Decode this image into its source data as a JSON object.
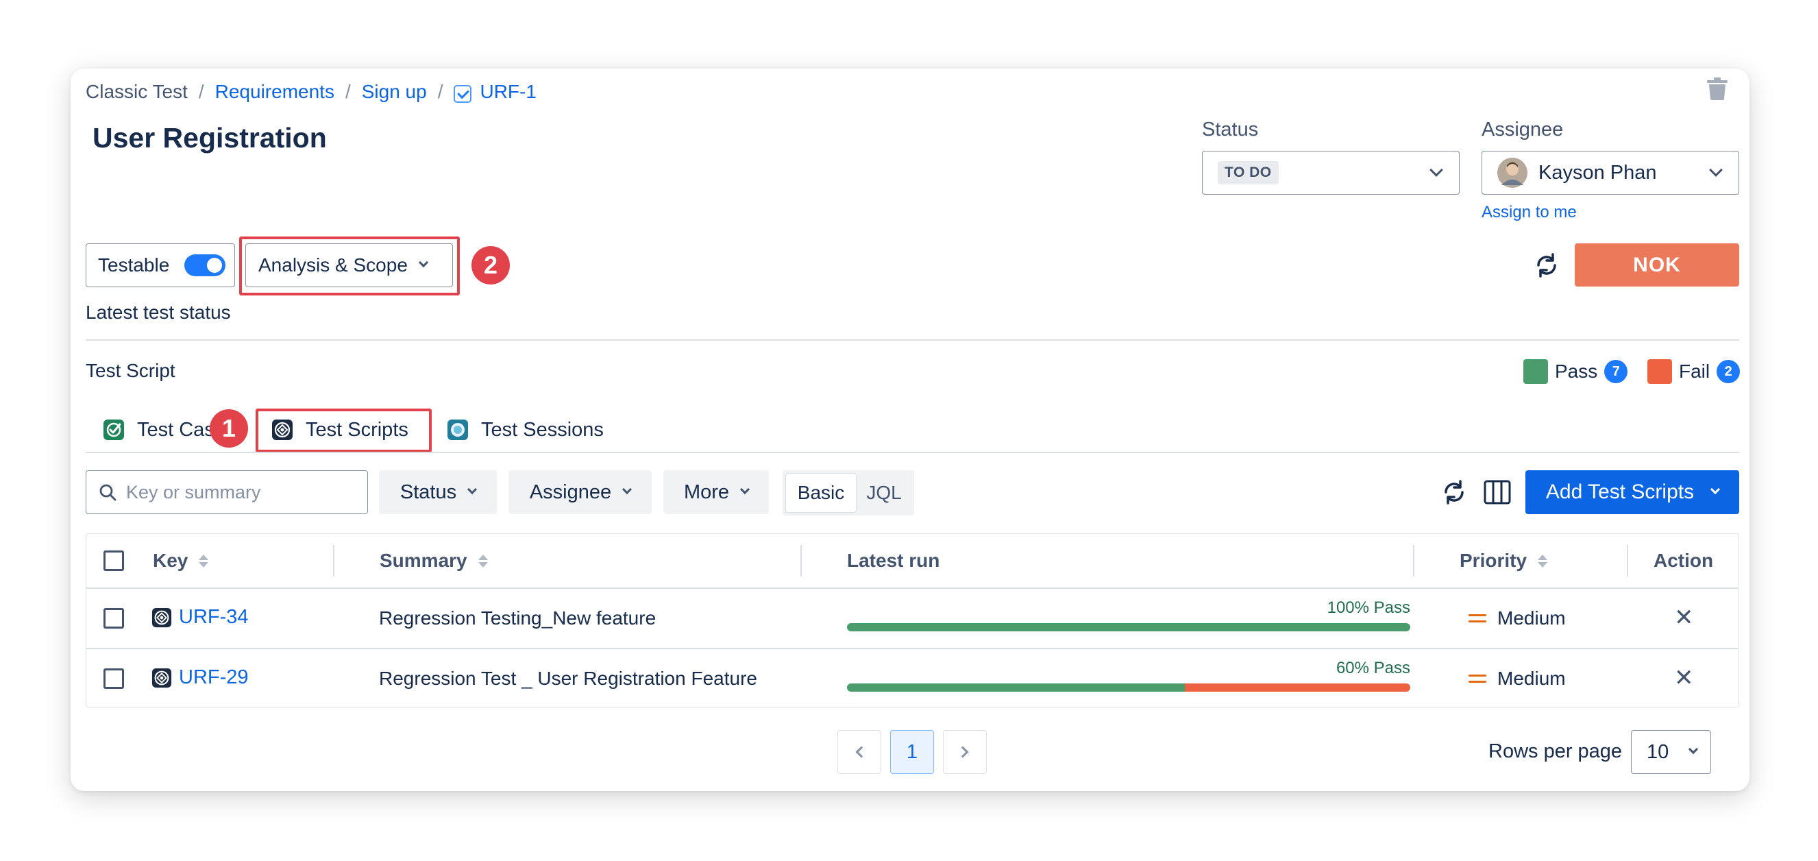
{
  "breadcrumb": {
    "project": "Classic Test",
    "requirements": "Requirements",
    "signup": "Sign up",
    "issue_key": "URF-1",
    "separator": "/"
  },
  "issue": {
    "title": "User Registration"
  },
  "status_field": {
    "label": "Status",
    "value": "TO DO"
  },
  "assignee_field": {
    "label": "Assignee",
    "value": "Kayson Phan",
    "assign_to_me": "Assign to me"
  },
  "controls": {
    "testable_label": "Testable",
    "testable_on": true,
    "analysis_label": "Analysis & Scope",
    "callout_1": "1",
    "callout_2": "2",
    "nok_label": "NOK"
  },
  "latest_status": "Latest test status",
  "test_script_label": "Test Script",
  "legend": {
    "pass_label": "Pass",
    "pass_count": "7",
    "pass_color": "#4a9c6d",
    "fail_label": "Fail",
    "fail_count": "2",
    "fail_color": "#ed6240"
  },
  "tabs": [
    {
      "label": "Test Cases",
      "icon": "test-case-icon"
    },
    {
      "label": "Test Scripts",
      "icon": "test-script-icon"
    },
    {
      "label": "Test Sessions",
      "icon": "test-session-icon"
    }
  ],
  "tab_visible_label_0": "Test Cas",
  "toolbar": {
    "search_placeholder": "Key or summary",
    "status": "Status",
    "assignee": "Assignee",
    "more": "More",
    "basic": "Basic",
    "jql": "JQL",
    "add_label": "Add Test Scripts"
  },
  "table": {
    "headers": {
      "key": "Key",
      "summary": "Summary",
      "latest_run": "Latest run",
      "priority": "Priority",
      "action": "Action"
    },
    "rows": [
      {
        "key": "URF-34",
        "summary": "Regression Testing_New feature",
        "run_label": "100% Pass",
        "pass_fraction": 1.0,
        "priority": "Medium",
        "action": "✕"
      },
      {
        "key": "URF-29",
        "summary": "Regression Test _ User Registration Feature",
        "run_label": "60% Pass",
        "pass_fraction": 0.6,
        "priority": "Medium",
        "action": "✕"
      }
    ]
  },
  "pagination": {
    "current_page": "1",
    "rows_label": "Rows per page",
    "rows_value": "10"
  },
  "colors": {
    "accent": "#0c66e4",
    "nok": "#ec7a5a",
    "callout": "#e2434a"
  }
}
